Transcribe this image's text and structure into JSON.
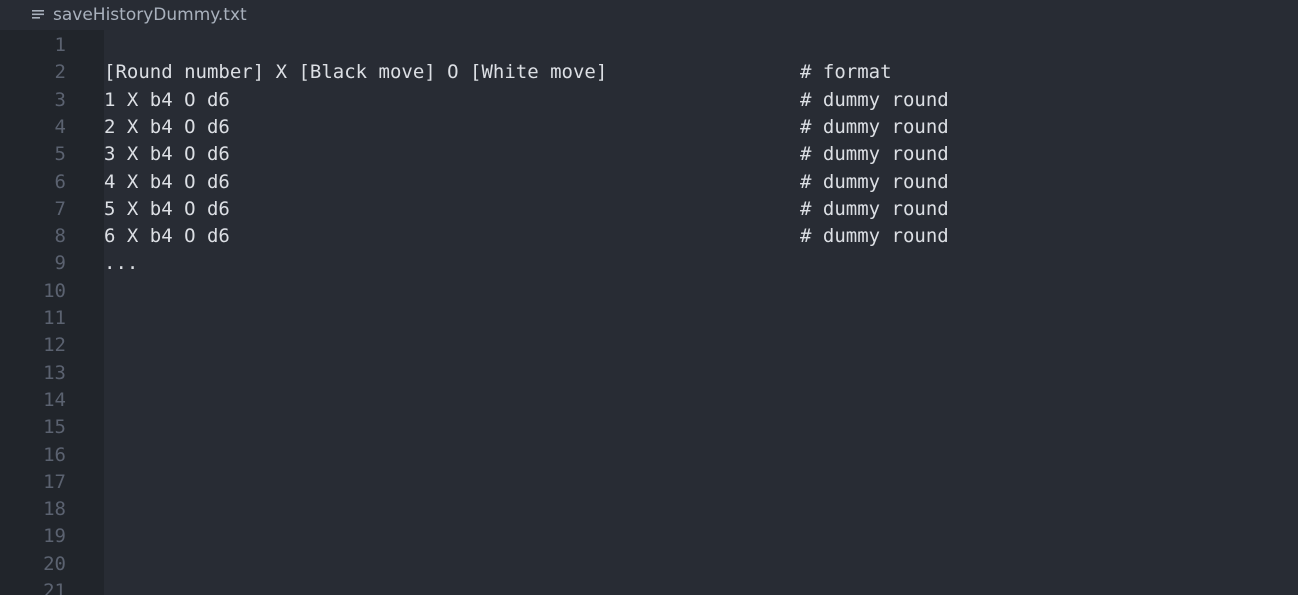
{
  "tab": {
    "icon": "text-file-icon",
    "title": "saveHistoryDummy.txt"
  },
  "line_numbers": [
    "1",
    "2",
    "3",
    "4",
    "5",
    "6",
    "7",
    "8",
    "9",
    "10",
    "11",
    "12",
    "13",
    "14",
    "15",
    "16",
    "17",
    "18",
    "19",
    "20",
    "21"
  ],
  "lines": [
    {
      "text": "",
      "comment": ""
    },
    {
      "text": "[Round number] X [Black move] O [White move]",
      "comment": "# format"
    },
    {
      "text": "1 X b4 O d6",
      "comment": "# dummy round"
    },
    {
      "text": "2 X b4 O d6",
      "comment": "# dummy round"
    },
    {
      "text": "3 X b4 O d6",
      "comment": "# dummy round"
    },
    {
      "text": "4 X b4 O d6",
      "comment": "# dummy round"
    },
    {
      "text": "5 X b4 O d6",
      "comment": "# dummy round"
    },
    {
      "text": "6 X b4 O d6",
      "comment": "# dummy round"
    },
    {
      "text": "...",
      "comment": ""
    },
    {
      "text": "",
      "comment": ""
    },
    {
      "text": "",
      "comment": ""
    },
    {
      "text": "",
      "comment": ""
    },
    {
      "text": "",
      "comment": ""
    },
    {
      "text": "",
      "comment": ""
    },
    {
      "text": "",
      "comment": ""
    },
    {
      "text": "",
      "comment": ""
    },
    {
      "text": "",
      "comment": ""
    },
    {
      "text": "",
      "comment": ""
    },
    {
      "text": "",
      "comment": ""
    },
    {
      "text": "",
      "comment": ""
    },
    {
      "text": "",
      "comment": ""
    }
  ],
  "colors": {
    "background": "#282c34",
    "gutter": "#21252b",
    "text": "#dcdfe4",
    "line_number": "#5b6270"
  }
}
